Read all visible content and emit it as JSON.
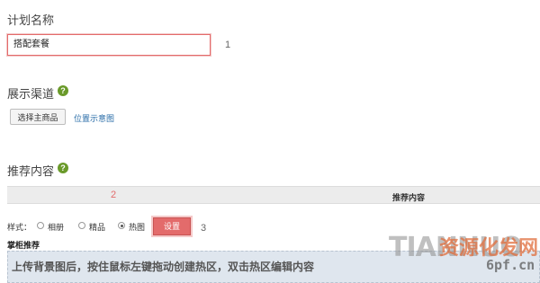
{
  "plan": {
    "label": "计划名称",
    "value": "搭配套餐",
    "marker": "1"
  },
  "channel": {
    "label": "展示渠道",
    "help_icon": "question-icon",
    "select_button": "选择主商品",
    "link": "位置示意图"
  },
  "recommend": {
    "label": "推荐内容",
    "help_icon": "question-icon",
    "table_marker": "2",
    "table_header": "推荐内容"
  },
  "style": {
    "label": "样式：",
    "options": [
      "相册",
      "精品",
      "热图"
    ],
    "selected": "热图",
    "settings_button": "设置",
    "marker": "3"
  },
  "section": {
    "title": "掌柜推荐",
    "banner_text": "上传背景图后，按住鼠标左键拖动创建热区，双击热区编辑内容"
  },
  "watermark": {
    "brand": "TIANNUO",
    "cn": "资源化发网",
    "url": "6pf.cn"
  },
  "colors": {
    "accent_red": "#e36b6b",
    "help_green": "#6a9a2a",
    "link_blue": "#2b6ea8"
  }
}
